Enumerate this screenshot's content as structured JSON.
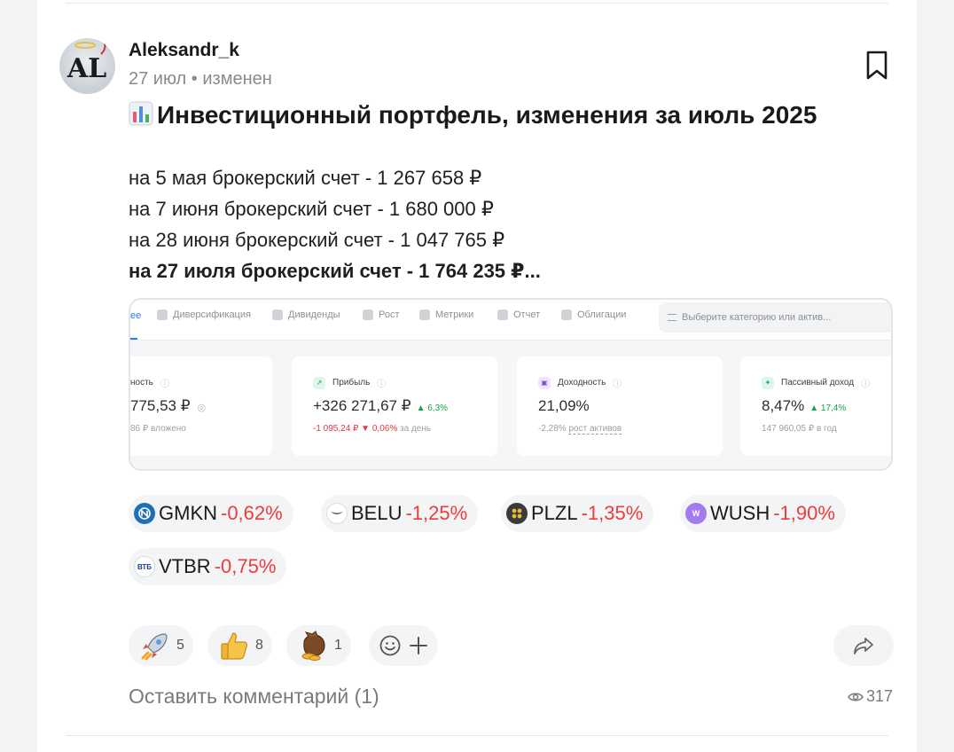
{
  "author": {
    "name": "Aleksandr_k",
    "date": "27 июл",
    "separator": "•",
    "edited": "изменен",
    "avatar_text": "AL"
  },
  "post": {
    "title": "Инвестиционный портфель, изменения за июль 2025",
    "title_icon": "bar-chart-emoji",
    "lines": [
      "на 5 мая брокерский счет - 1 267 658 ₽",
      "на 7 июня брокерский счет - 1 680 000 ₽",
      "на 28 июня брокерский счет - 1 047 765 ₽"
    ],
    "bold_line": "на 27 июля брокерский счет - 1 764 235 ₽..."
  },
  "screenshot": {
    "tabs": [
      "ее",
      "Диверсификация",
      "Дивиденды",
      "Рост",
      "Метрики",
      "Отчет",
      "Облигации"
    ],
    "search_placeholder": "Выберите категорию или актив...",
    "cards": [
      {
        "label": "ность",
        "value": "775,53 ₽",
        "change": "",
        "sub_red": "",
        "sub": "86 ₽ вложено"
      },
      {
        "label": "Прибыль",
        "value": "+326 271,67 ₽",
        "change": "▲ 6,3%",
        "sub_red": "-1 095,24 ₽ ▼ 0,06%",
        "sub": "за день"
      },
      {
        "label": "Доходность",
        "value": "21,09%",
        "change": "",
        "sub_red": "",
        "sub_prefix": "-2,28%",
        "sub": "рост активов"
      },
      {
        "label": "Пассивный доход",
        "value": "8,47%",
        "change": "▲ 17,4%",
        "sub_red": "",
        "sub": "147 960,05 ₽ в год"
      }
    ],
    "colors": {
      "accent": "#2f7bf5",
      "positive": "#16a34a",
      "negative": "#e0383e"
    }
  },
  "tickers": [
    {
      "ticker": "GMKN",
      "change": "-0,62%",
      "logo_color": "#1d6fb8",
      "logo_text": ""
    },
    {
      "ticker": "BELU",
      "change": "-1,25%",
      "logo_color": "#ffffff",
      "logo_text": ""
    },
    {
      "ticker": "PLZL",
      "change": "-1,35%",
      "logo_color": "#3a3a3a",
      "logo_text": ""
    },
    {
      "ticker": "WUSH",
      "change": "-1,90%",
      "logo_color": "#a27bf0",
      "logo_text": "W"
    },
    {
      "ticker": "VTBR",
      "change": "-0,75%",
      "logo_color": "#ffffff",
      "logo_text": "ВТБ"
    }
  ],
  "reactions": [
    {
      "emoji": "rocket",
      "count": "5"
    },
    {
      "emoji": "thumbs-up",
      "count": "8"
    },
    {
      "emoji": "money-bag",
      "count": "1"
    }
  ],
  "footer": {
    "comment_label": "Оставить комментарий (1)",
    "views": "317"
  }
}
